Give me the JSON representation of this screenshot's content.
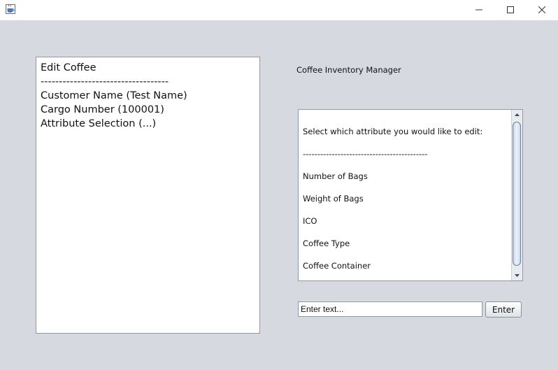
{
  "window": {
    "app_icon": "java-coffee-cup-icon",
    "controls": [
      "minimize-icon",
      "maximize-icon",
      "close-icon"
    ]
  },
  "left_panel": {
    "lines": [
      "Edit Coffee",
      "-----------------------------------",
      "Customer Name (Test Name)",
      "Cargo Number (100001)",
      "Attribute Selection (...)"
    ]
  },
  "app_title": "Coffee Inventory Manager",
  "attribute_list": {
    "items": [
      "Select which attribute you would like to edit:",
      "-------------------------------------------",
      "Number of Bags",
      "Weight of Bags",
      "ICO",
      "Coffee Type",
      "Coffee Container"
    ]
  },
  "input": {
    "value": "Enter text..."
  },
  "enter_button": {
    "label": "Enter"
  }
}
